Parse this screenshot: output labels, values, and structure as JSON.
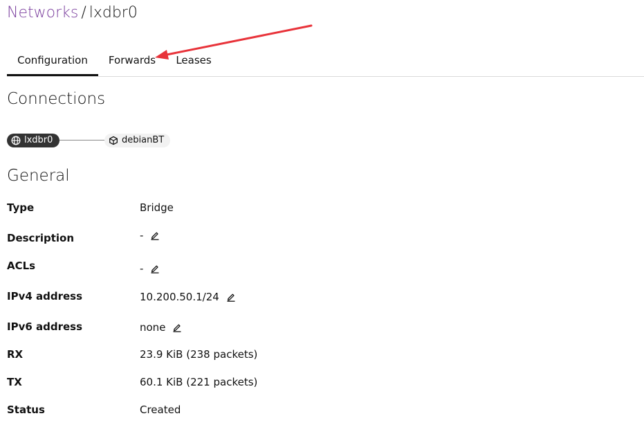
{
  "breadcrumb": {
    "parent": "Networks",
    "separator": "/",
    "current": "lxdbr0"
  },
  "tabs": [
    {
      "label": "Configuration",
      "active": true
    },
    {
      "label": "Forwards",
      "active": false
    },
    {
      "label": "Leases",
      "active": false
    }
  ],
  "connections": {
    "heading": "Connections",
    "network_chip": {
      "label": "lxdbr0",
      "icon": "globe-icon"
    },
    "instance_chip": {
      "label": "debianBT",
      "icon": "cube-icon"
    }
  },
  "general": {
    "heading": "General",
    "rows": [
      {
        "label": "Type",
        "value": "Bridge",
        "editable": false
      },
      {
        "label": "Description",
        "value": "-",
        "editable": true
      },
      {
        "label": "ACLs",
        "value": "-",
        "editable": true
      },
      {
        "label": "IPv4 address",
        "value": "10.200.50.1/24",
        "editable": true
      },
      {
        "label": "IPv6 address",
        "value": "none",
        "editable": true
      },
      {
        "label": "RX",
        "value": "23.9 KiB (238 packets)",
        "editable": false
      },
      {
        "label": "TX",
        "value": "60.1 KiB (221 packets)",
        "editable": false
      },
      {
        "label": "Status",
        "value": "Created",
        "editable": false
      }
    ]
  },
  "colors": {
    "link": "#7b3f9e",
    "annotation": "#e8333a",
    "chip_dark": "#333333",
    "chip_light": "#f2f2f2"
  }
}
